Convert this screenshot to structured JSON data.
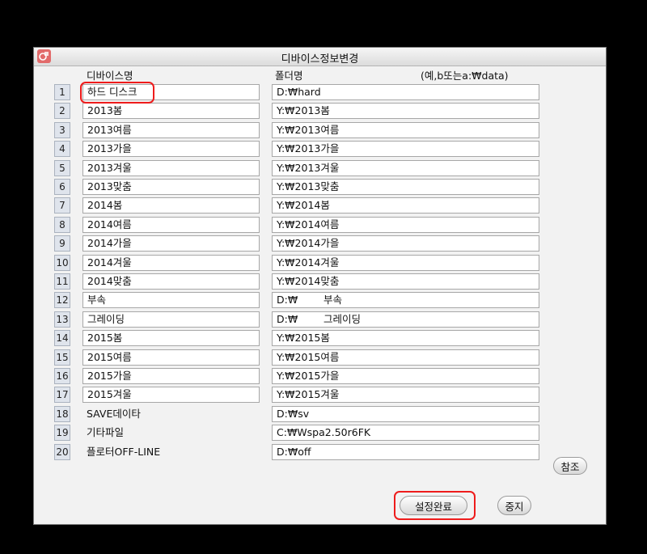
{
  "window": {
    "title": "디바이스정보변경"
  },
  "headers": {
    "device_name": "디바이스명",
    "folder_name": "폴더명",
    "hint": "(예,b또는a:₩data)"
  },
  "rows": [
    {
      "num": "1",
      "name": "하드 디스크",
      "path": "D:₩hard"
    },
    {
      "num": "2",
      "name": "2013봄",
      "path": "Y:₩2013봄"
    },
    {
      "num": "3",
      "name": "2013여름",
      "path": "Y:₩2013여름"
    },
    {
      "num": "4",
      "name": "2013가을",
      "path": "Y:₩2013가을"
    },
    {
      "num": "5",
      "name": "2013겨울",
      "path": "Y:₩2013겨울"
    },
    {
      "num": "6",
      "name": "2013맞춤",
      "path": "Y:₩2013맞춤"
    },
    {
      "num": "7",
      "name": "2014봄",
      "path": "Y:₩2014봄"
    },
    {
      "num": "8",
      "name": "2014여름",
      "path": "Y:₩2014여름"
    },
    {
      "num": "9",
      "name": "2014가을",
      "path": "Y:₩2014가을"
    },
    {
      "num": "10",
      "name": "2014겨울",
      "path": "Y:₩2014겨울"
    },
    {
      "num": "11",
      "name": "2014맞춤",
      "path": "Y:₩2014맞춤"
    },
    {
      "num": "12",
      "name": "부속",
      "path": "D:₩        부속"
    },
    {
      "num": "13",
      "name": "그레이딩",
      "path": "D:₩        그레이딩"
    },
    {
      "num": "14",
      "name": "2015봄",
      "path": "Y:₩2015봄"
    },
    {
      "num": "15",
      "name": "2015여름",
      "path": "Y:₩2015여름"
    },
    {
      "num": "16",
      "name": "2015가을",
      "path": "Y:₩2015가을"
    },
    {
      "num": "17",
      "name": "2015겨울",
      "path": "Y:₩2015겨울"
    },
    {
      "num": "18",
      "name": "SAVE데이타",
      "path": "D:₩sv"
    },
    {
      "num": "19",
      "name": "기타파일",
      "path": "C:₩Wspa2.50r6FK"
    },
    {
      "num": "20",
      "name": "플로터OFF-LINE",
      "path": "D:₩off"
    }
  ],
  "buttons": {
    "browse": "참조",
    "complete": "설정완료",
    "stop": "중지"
  },
  "colors": {
    "highlight": "#ee1c1c",
    "background": "#000000",
    "dialog": "#f2f2f2"
  }
}
